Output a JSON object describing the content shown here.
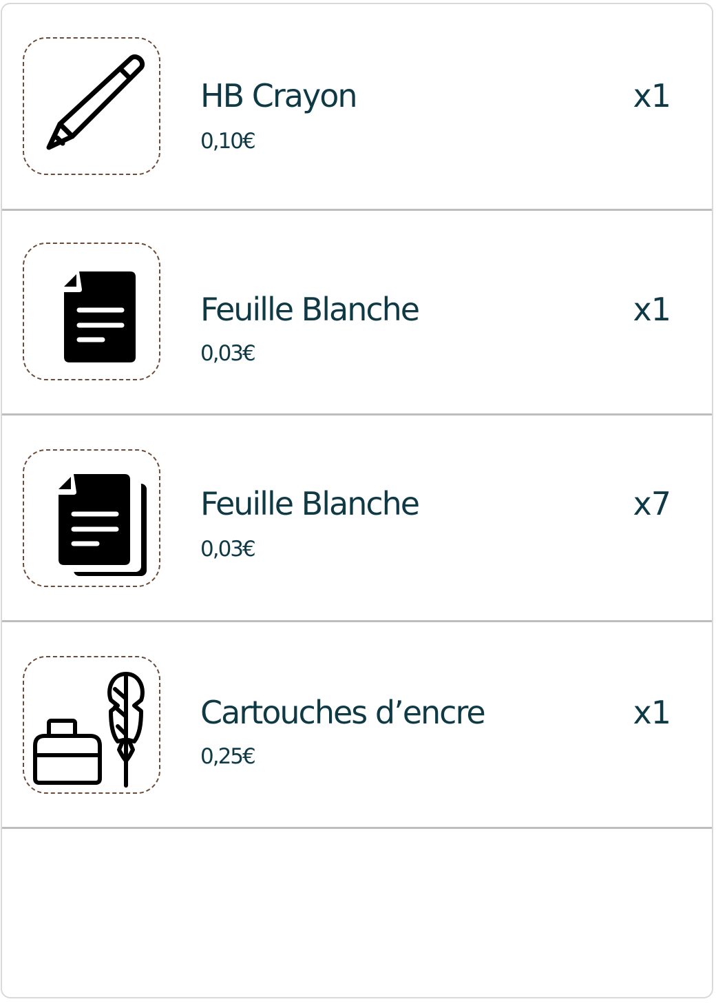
{
  "items": [
    {
      "name": "HB Crayon",
      "price": "0,10€",
      "quantity": "x1",
      "icon": "pencil-icon"
    },
    {
      "name": "Feuille Blanche",
      "price": "0,03€",
      "quantity": "x1",
      "icon": "document-icon"
    },
    {
      "name": "Feuille Blanche",
      "price": "0,03€",
      "quantity": "x7",
      "icon": "documents-stack-icon"
    },
    {
      "name": "Cartouches d’encre",
      "price": "0,25€",
      "quantity": "x1",
      "icon": "ink-and-quill-icon"
    }
  ],
  "colors": {
    "text": "#0f3a45",
    "icon": "#000000",
    "frame_border": "#6a4a38",
    "divider": "#bdbdbd"
  }
}
